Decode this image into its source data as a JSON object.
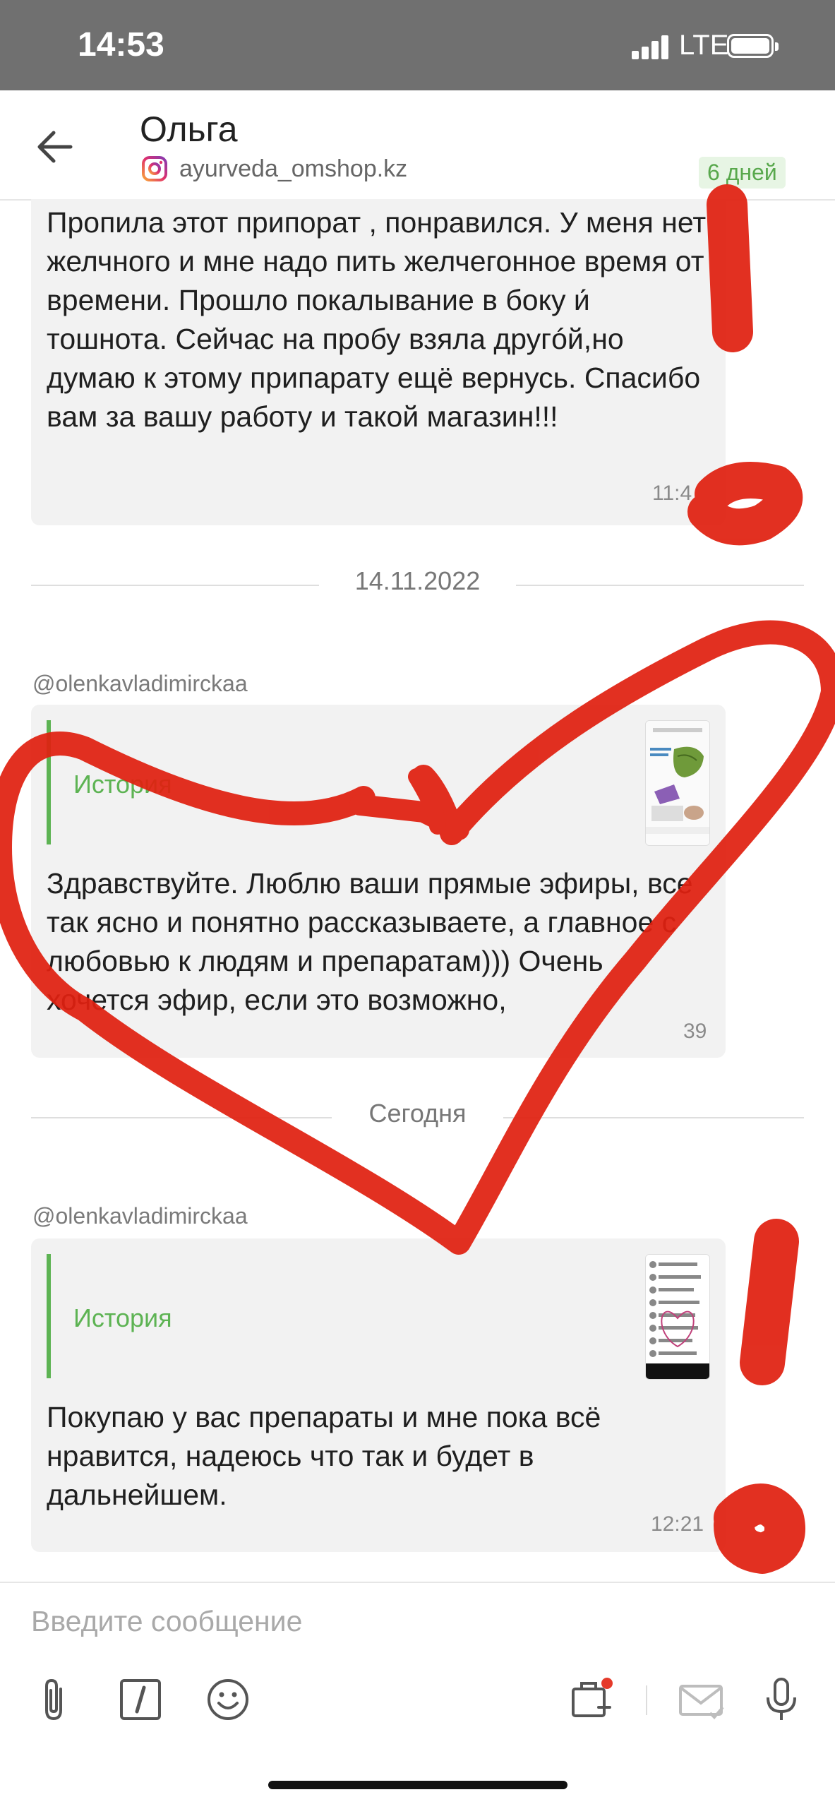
{
  "status_bar": {
    "time": "14:53",
    "network": "LTE"
  },
  "header": {
    "contact_name": "Ольга",
    "channel_handle": "ayurveda_omshop.kz",
    "age_badge": "6 дней"
  },
  "messages": [
    {
      "text": "Пропила этот припорат , понравился. У меня нет желчного и мне надо пить желчегонное время от времени. Прошло покалывание в боку и́ тошнота. Сейчас на пробу взяла другóй,но думаю к этому припарату ещё вернусь. Спасибо вам за вашу работу и такой магазин!!!",
      "time": "11:4"
    },
    {
      "date_separator": "14.11.2022",
      "sender": "@olenkavladimirckaa",
      "story_label": "История",
      "text": "Здравствуйте. Люблю ваши прямые эфиры, все так ясно и понятно рассказываете, а главное с любовью к людям и препаратам))) Очень хочется эфир, если это возможно,",
      "time": "39"
    },
    {
      "date_separator": "Сегодня",
      "sender": "@olenkavladimirckaa",
      "story_label": "История",
      "text": "Покупаю у вас препараты и мне пока всё нравится, надеюсь что так и будет в дальнейшем.",
      "time": "12:21"
    }
  ],
  "composer": {
    "placeholder": "Введите сообщение"
  },
  "colors": {
    "status_bar": "#707070",
    "accent_green": "#5db353",
    "bubble": "#f2f2f2",
    "marker_red": "#e02010"
  },
  "icons": [
    "back-arrow-icon",
    "instagram-icon",
    "paperclip-icon",
    "slash-command-icon",
    "emoji-icon",
    "product-card-icon",
    "mail-icon",
    "microphone-icon"
  ]
}
